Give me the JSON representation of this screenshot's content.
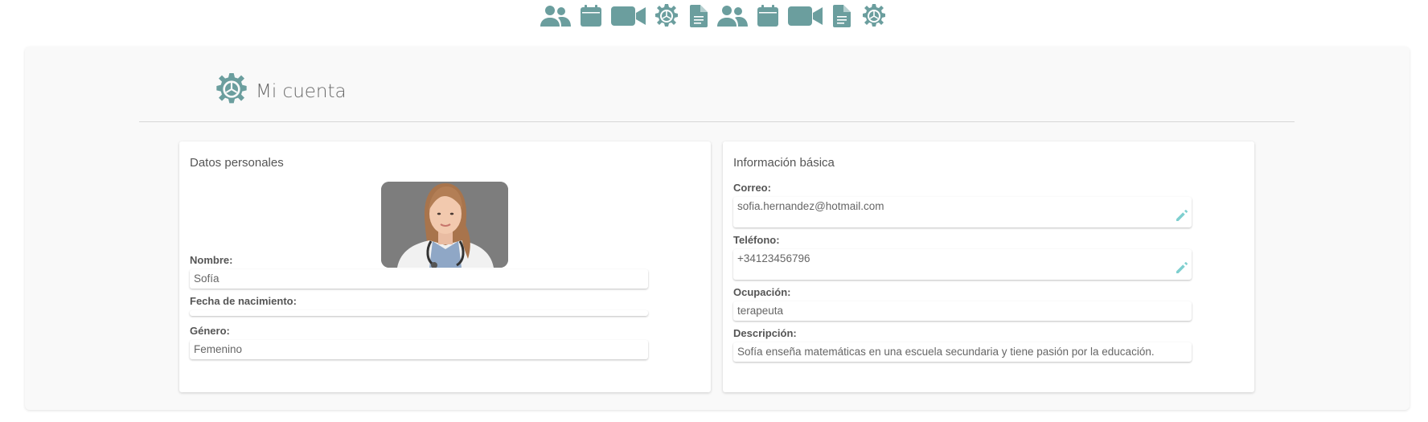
{
  "nav": {
    "icons": [
      "users-icon",
      "calendar-icon",
      "video-icon",
      "gear-icon",
      "document-icon",
      "users-icon",
      "calendar-icon",
      "video-icon",
      "document-icon",
      "gear-icon"
    ]
  },
  "header": {
    "title": "Mi cuenta",
    "icon": "gear-icon"
  },
  "personal": {
    "title": "Datos personales",
    "photo": "profile-photo",
    "fields": [
      {
        "label": "Nombre:",
        "value": "Sofía"
      },
      {
        "label": "Fecha de nacimiento:",
        "value": ""
      },
      {
        "label": "Género:",
        "value": "Femenino"
      }
    ]
  },
  "basic": {
    "title": "Información básica",
    "fields": [
      {
        "label": "Correo:",
        "value": "sofia.hernandez@hotmail.com",
        "editable": true
      },
      {
        "label": "Teléfono:",
        "value": "+34123456796",
        "editable": true
      },
      {
        "label": "Ocupación:",
        "value": "terapeuta"
      },
      {
        "label": "Descripción:",
        "value": "Sofía enseña matemáticas en una escuela secundaria y tiene pasión por la educación."
      }
    ]
  },
  "colors": {
    "accent": "#6b9e9e",
    "edit": "#7ecfcf",
    "panel": "#f9f9f9"
  }
}
